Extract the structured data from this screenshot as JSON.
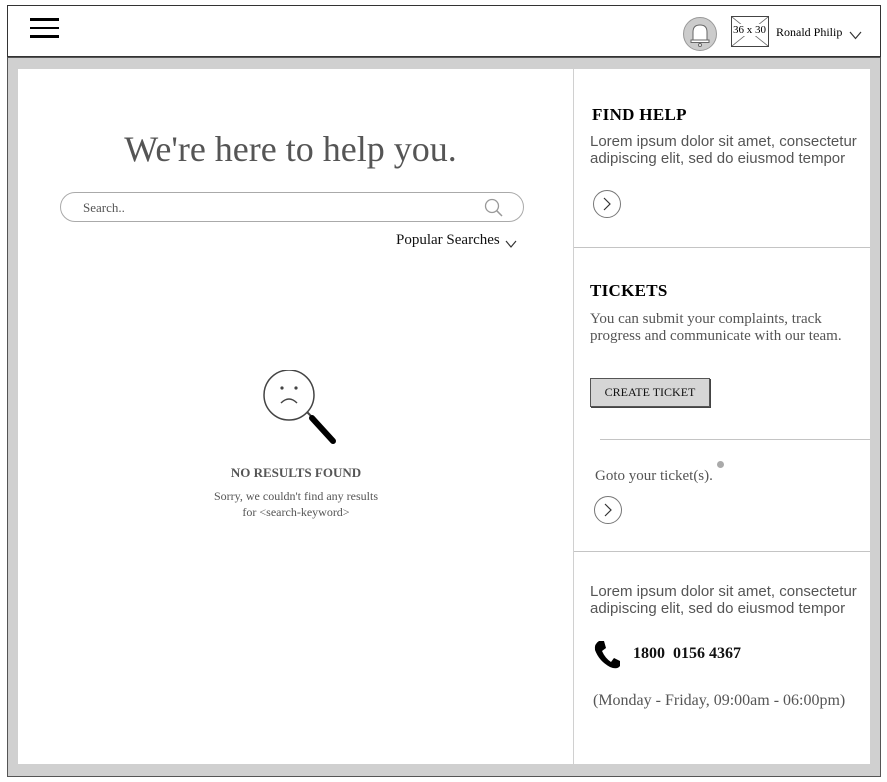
{
  "header": {
    "avatar_placeholder": "36 x 30",
    "user_name": "Ronald Philip"
  },
  "main": {
    "headline": "We're here to help you.",
    "search_placeholder": "Search..",
    "popular_searches": "Popular Searches",
    "no_results_title": "NO RESULTS FOUND",
    "no_results_line1": "Sorry, we couldn't find any results",
    "no_results_line2": "for <search-keyword>"
  },
  "sidebar": {
    "find_help": {
      "title": "FIND HELP",
      "text": "Lorem ipsum dolor sit amet, consectetur adipiscing elit, sed do eiusmod tempor"
    },
    "tickets": {
      "title": "TICKETS",
      "text": "You can submit your complaints, track progress and communicate with our team.",
      "create_button": "CREATE TICKET",
      "goto": "Goto your ticket(s)."
    },
    "contact": {
      "text": "Lorem ipsum dolor sit amet, consectetur adipiscing elit, sed do eiusmod tempor",
      "phone": "1800  0156 4367",
      "hours": "(Monday - Friday, 09:00am - 06:00pm)"
    }
  },
  "icons": {
    "menu": "hamburger-menu-icon",
    "notification": "bell-icon",
    "search": "search-icon",
    "arrow": "chevron-right-icon",
    "phone": "phone-icon",
    "no_results": "sad-magnifier-icon"
  },
  "colors": {
    "frame": "#d0d0d0",
    "button_bg": "#d6d6d6",
    "muted_text": "#555555"
  }
}
